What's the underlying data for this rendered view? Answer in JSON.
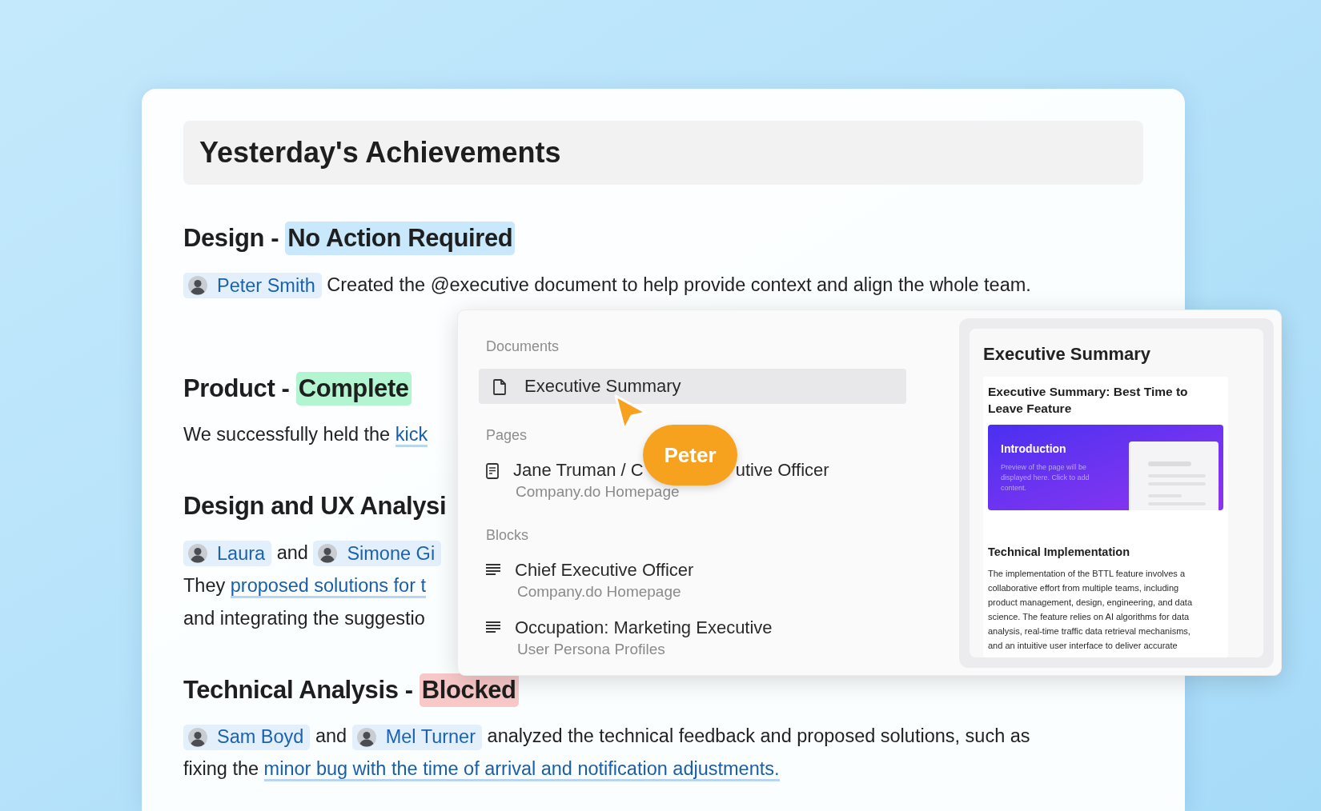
{
  "title": "Yesterday's Achievements",
  "sections": [
    {
      "heading": "Design - ",
      "status": {
        "label": "No Action Required",
        "color": "#c9e8fb"
      },
      "lines": [
        [
          {
            "kind": "mention",
            "text": "Peter Smith"
          },
          {
            "kind": "text",
            "text": " Created the @executive document to help provide context and align the whole team."
          }
        ]
      ]
    },
    {
      "heading": "Product - ",
      "status": {
        "label": "Complete",
        "color": "#b2f5d0"
      },
      "lines": [
        [
          {
            "kind": "text",
            "text": "We successfully held the "
          },
          {
            "kind": "link",
            "text": "kick"
          }
        ]
      ]
    },
    {
      "heading": "Design and UX Analysi",
      "lines": [
        [
          {
            "kind": "mention",
            "text": "Laura"
          },
          {
            "kind": "text",
            "text": " and "
          },
          {
            "kind": "mention",
            "text": "Simone Gi"
          }
        ],
        [
          {
            "kind": "text",
            "text": "They "
          },
          {
            "kind": "link",
            "text": "proposed solutions for t"
          }
        ],
        [
          {
            "kind": "text",
            "text": "and integrating the suggestio"
          }
        ]
      ]
    },
    {
      "heading": "Technical Analysis - ",
      "status": {
        "label": "Blocked",
        "color": "#f8c8c8"
      },
      "lines": [
        [
          {
            "kind": "mention",
            "text": "Sam Boyd"
          },
          {
            "kind": "text",
            "text": " and "
          },
          {
            "kind": "mention",
            "text": "Mel Turner"
          },
          {
            "kind": "text",
            "text": " analyzed the technical feedback and proposed solutions, such as"
          }
        ],
        [
          {
            "kind": "text",
            "text": "fixing the "
          },
          {
            "kind": "link",
            "text": "minor bug with the time of arrival and notification adjustments."
          }
        ]
      ]
    }
  ],
  "dropdown": {
    "groups": [
      {
        "label": "Documents",
        "items": [
          {
            "kind": "document",
            "title": "Executive Summary",
            "selected": true
          }
        ]
      },
      {
        "label": "Pages",
        "items": [
          {
            "kind": "page",
            "title": "Jane Truman / C",
            "title_end": "utive Officer",
            "subtitle": "Company.do Homepage",
            "selected": false
          }
        ]
      },
      {
        "label": "Blocks",
        "items": [
          {
            "kind": "block",
            "title": "Chief Executive Officer",
            "subtitle": "Company.do Homepage",
            "selected": false
          },
          {
            "kind": "block",
            "title": "Occupation: Marketing Executive",
            "subtitle": "User Persona Profiles",
            "selected": false
          }
        ]
      }
    ],
    "cursor": {
      "label": "Peter"
    },
    "preview": {
      "heading": "Executive Summary",
      "doc_title": "Executive Summary: Best Time to Leave Feature",
      "banner_title": "Introduction",
      "banner_text": "Preview of the page will be displayed here. Click to add content.",
      "section_title": "Technical Implementation",
      "section_text": "The implementation of the BTTL feature involves a collaborative effort from multiple teams, including product management, design, engineering, and data science. The feature relies on AI algorithms for data analysis, real-time traffic data retrieval mechanisms, and an intuitive user interface to deliver accurate"
    }
  }
}
